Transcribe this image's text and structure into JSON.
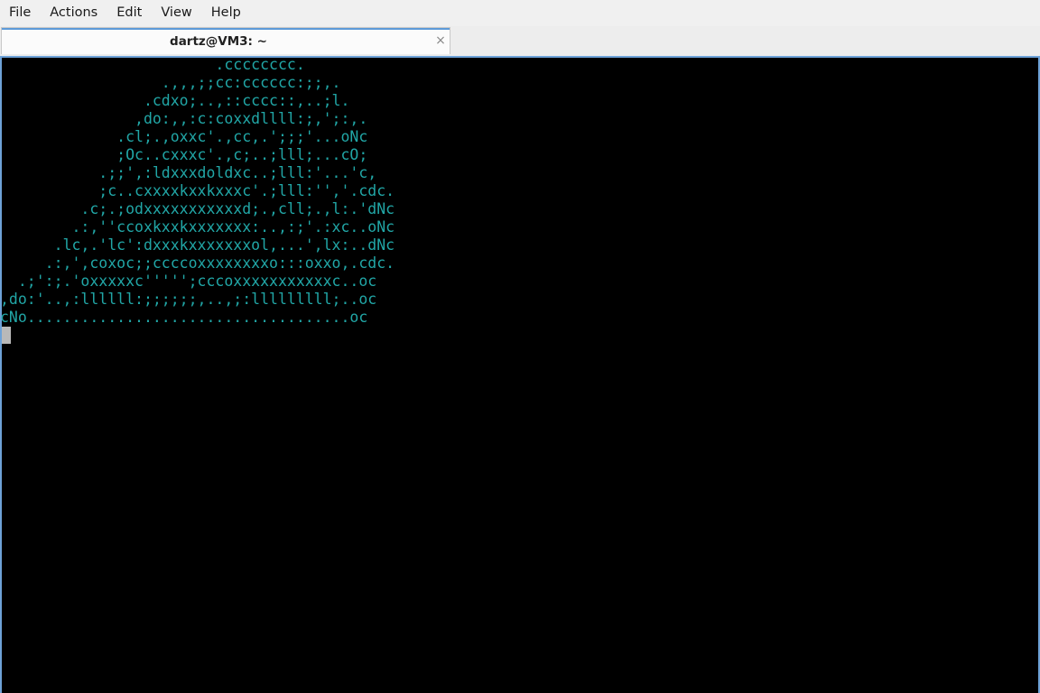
{
  "menubar": {
    "items": [
      "File",
      "Actions",
      "Edit",
      "View",
      "Help"
    ]
  },
  "tab": {
    "title": "dartz@VM3: ~",
    "close_glyph": "×"
  },
  "terminal": {
    "text_color": "#21a6a6",
    "background": "#000000",
    "lines": [
      "                        .cccccccc.",
      "                  .,,,;;cc:cccccc:;;,.",
      "                .cdxo;..,::cccc::,..;l.",
      "               ,do:,,:c:coxxdllll:;,';:,.",
      "             .cl;.,oxxc'.,cc,.';;;'...oNc",
      "             ;Oc..cxxxc'.,c;..;lll;...cO;",
      "           .;;',:ldxxxdoldxc..;lll:'...'c,",
      "           ;c..cxxxxkxxkxxxc'.;lll:'','.cdc.",
      "         .c;.;odxxxxxxxxxxxd;.,cll;.,l:.'dNc",
      "        .:,''ccoxkxxkxxxxxxx:..,:;'.:xc..oNc",
      "      .lc,.'lc':dxxxkxxxxxxxol,...',lx:..dNc",
      "     .:,',coxoc;;ccccoxxxxxxxxo:::oxxo,.cdc.",
      "  .;':;.'oxxxxxc''''';cccoxxxxxxxxxxxc..oc",
      ",do:'..,:llllll:;;;;;;,..,;:lllllllll;..oc",
      "cNo....................................oc"
    ]
  }
}
